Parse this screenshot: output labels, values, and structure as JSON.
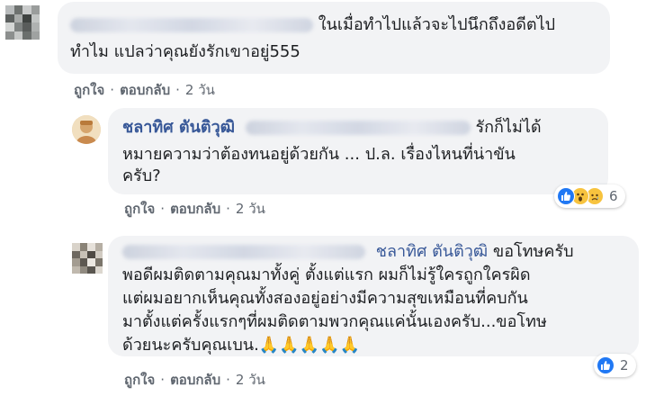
{
  "comments": [
    {
      "line1_text": "ในเมื่อทำไปแล้วจะไปนึกถึงอดีตไป",
      "line2_text": "ทำไม แปลว่าคุณยังรักเขาอยู่555",
      "actions": {
        "like": "ถูกใจ",
        "reply": "ตอบกลับ",
        "time": "2 วัน"
      }
    },
    {
      "author": "ชลาทิศ ตันติวุฒิ",
      "line1_tail": "รักก็ไม่ได้",
      "line2_text": "หมายความว่าต้องทนอยู่ด้วยกัน ... ป.ล. เรื่องไหนที่น่าขัน",
      "line3_text": "ครับ?",
      "actions": {
        "like": "ถูกใจ",
        "reply": "ตอบกลับ",
        "time": "2 วัน"
      },
      "reaction_count": "6"
    },
    {
      "tagged_name": "ชลาทิศ ตันติวุฒิ",
      "line1_tail": "ขอโทษครับ",
      "line2_text": "พอดีผมติดตามคุณมาทั้งคู่ ตั้งแต่แรก ผมก็ไม่รู้ใครถูกใครผิด",
      "line3_text": "แต่ผมอยากเห็นคุณทั้งสองอยู่อย่างมีความสุขเหมือนที่คบกัน",
      "line4_text": "มาตั้งแต่ครั้งแรกๆที่ผมติดตามพวกคุณแค่นั้นเองครับ...ขอโทษ",
      "line5_text": "ด้วยนะครับคุณเบน.",
      "prayer_emojis": "🙏🙏🙏🙏🙏",
      "actions": {
        "like": "ถูกใจ",
        "reply": "ตอบกลับ",
        "time": "2 วัน"
      },
      "reaction_count": "2"
    }
  ],
  "separator": "·",
  "colors": {
    "link": "#385898",
    "bubble": "#f2f3f5",
    "meta": "#606770",
    "like": "#2078f4",
    "emoji": "#f7c33e"
  }
}
